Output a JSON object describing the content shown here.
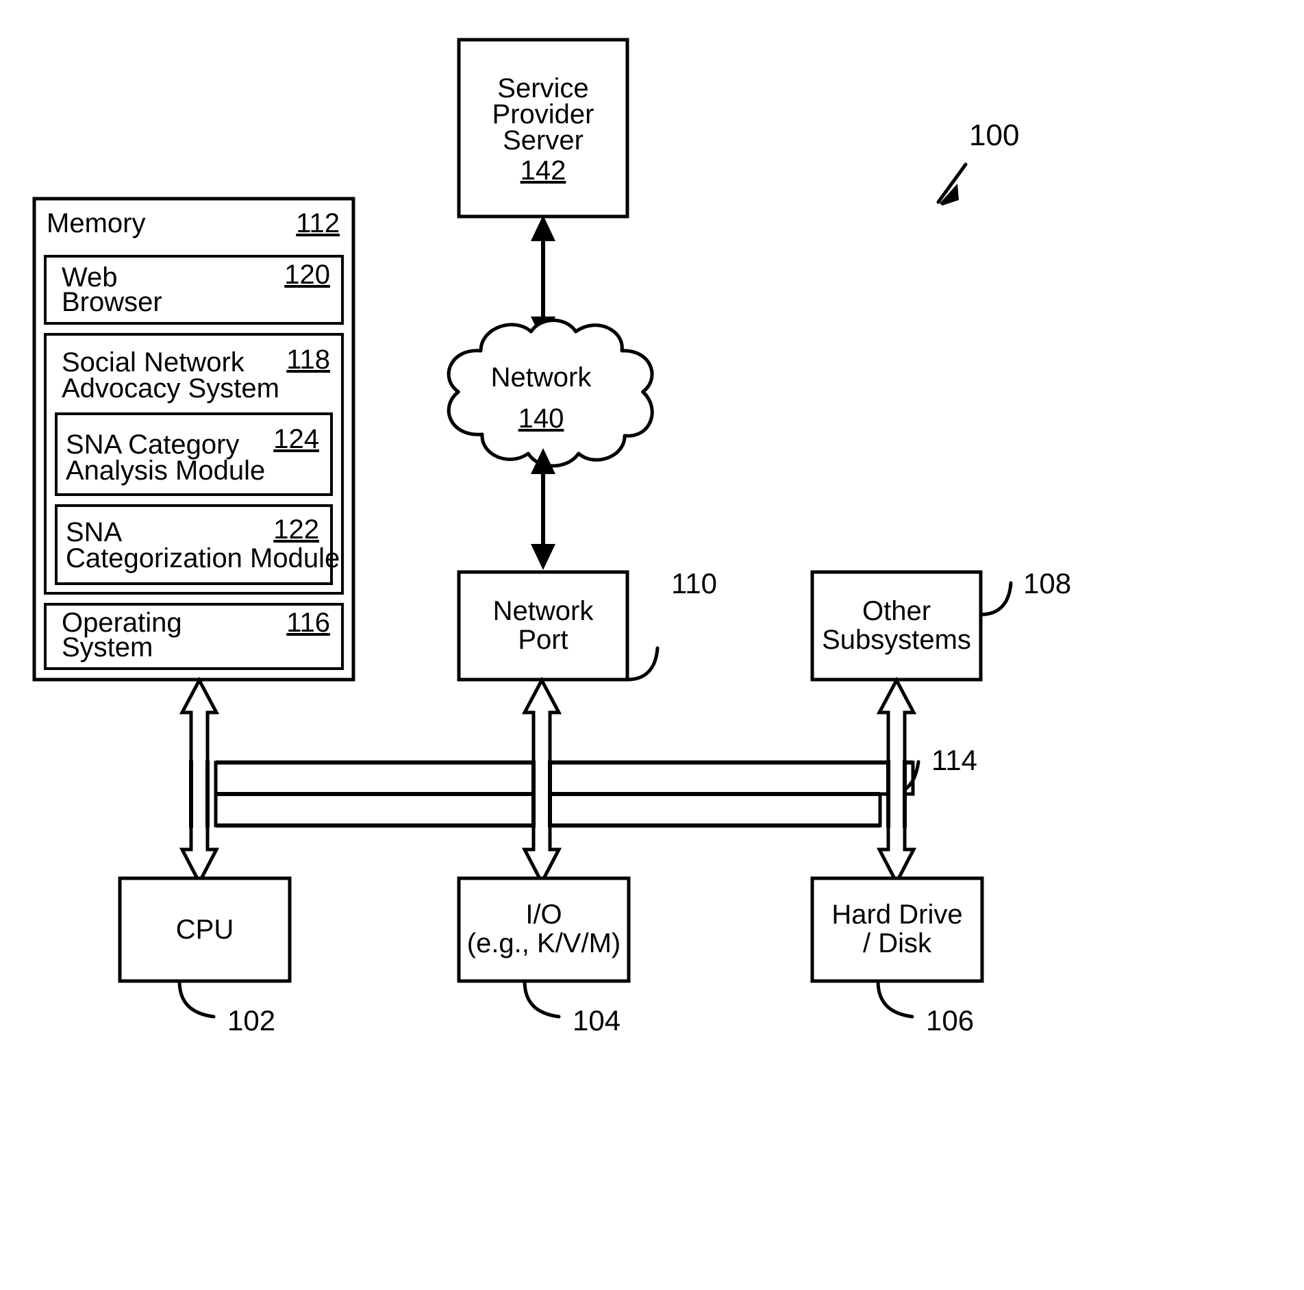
{
  "figure": {
    "number": "100"
  },
  "nodes": {
    "service_provider_server": {
      "line1": "Service",
      "line2": "Provider",
      "line3": "Server",
      "ref": "142"
    },
    "network_cloud": {
      "label": "Network",
      "ref": "140"
    },
    "memory": {
      "label": "Memory",
      "ref": "112",
      "children": [
        {
          "name": "web-browser",
          "line1": "Web",
          "line2": "Browser",
          "ref": "120"
        },
        {
          "name": "social-network-advocacy-system",
          "line1": "Social Network",
          "line2": "Advocacy System",
          "ref": "118",
          "children": [
            {
              "name": "sna-category-analysis-module",
              "line1": "SNA Category",
              "line2": "Analysis Module",
              "ref": "124"
            },
            {
              "name": "sna-categorization-module",
              "line1": "SNA",
              "line2": "Categorization Module",
              "ref": "122"
            }
          ]
        },
        {
          "name": "operating-system",
          "line1": "Operating",
          "line2": "System",
          "ref": "116"
        }
      ]
    },
    "network_port": {
      "line1": "Network",
      "line2": "Port",
      "ref": "110"
    },
    "other_subsystems": {
      "line1": "Other",
      "line2": "Subsystems",
      "ref": "108"
    },
    "cpu": {
      "line1": "CPU",
      "ref": "102"
    },
    "io": {
      "line1": "I/O",
      "line2": "(e.g., K/V/M)",
      "ref": "104"
    },
    "hard_drive": {
      "line1": "Hard Drive",
      "line2": "/ Disk",
      "ref": "106"
    },
    "bus": {
      "ref": "114"
    }
  },
  "colors": {
    "stroke": "#000000",
    "background": "#ffffff"
  }
}
